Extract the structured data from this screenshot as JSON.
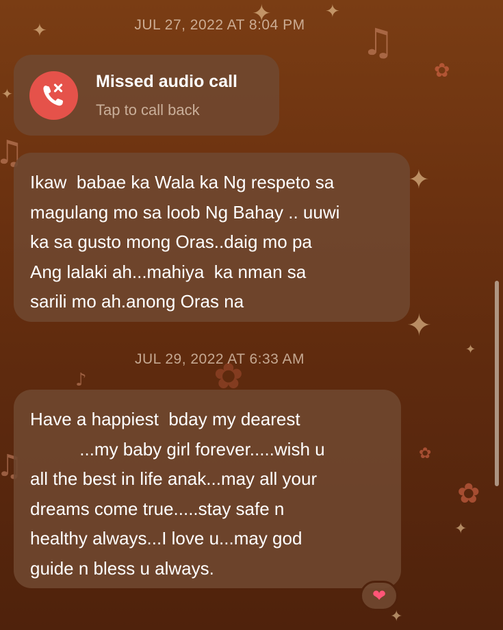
{
  "conversation": {
    "items": [
      {
        "type": "timestamp",
        "text": "JUL 27, 2022 AT 8:04 PM"
      },
      {
        "type": "call",
        "title": "Missed audio call",
        "subtitle": "Tap to call back",
        "icon": "missed-call-icon"
      },
      {
        "type": "message",
        "text": "Ikaw  babae ka Wala ka Ng respeto sa\nmagulang mo sa loob Ng Bahay .. uuwi\nka sa gusto mong Oras..daig mo pa\nAng lalaki ah...mahiya  ka nman sa\nsarili mo ah.anong Oras na"
      },
      {
        "type": "timestamp",
        "text": "JUL 29, 2022 AT 6:33 AM"
      },
      {
        "type": "message",
        "text": "Have a happiest  bday my dearest\n          ...my baby girl forever.....wish u\nall the best in life anak...may all your\ndreams come true.....stay safe n\nhealthy always...I love u...may god\nguide n bless u always.",
        "reaction": "❤"
      }
    ]
  },
  "colors": {
    "background": "#6c3210",
    "bubble": "#704830",
    "missed_call_red": "#e5524a",
    "text": "#ffffff",
    "secondary_text": "#ebd7c3"
  }
}
